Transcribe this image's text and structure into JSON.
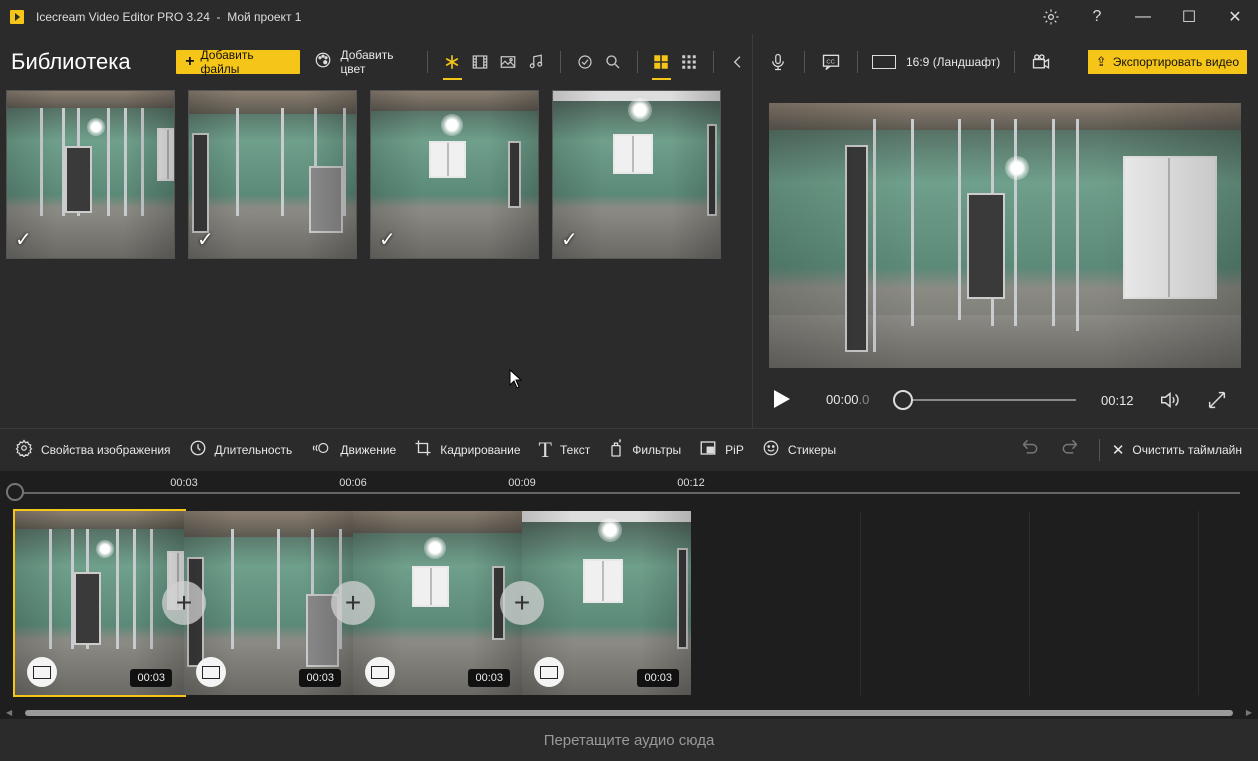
{
  "window": {
    "title": "Icecream Video Editor PRO 3.24  -  Мой проект 1",
    "settings_icon": "gear-icon",
    "help_label": "?",
    "minimize_label": "—",
    "maximize_label": "☐",
    "close_label": "✕"
  },
  "library": {
    "title": "Библиотека",
    "add_files_label": "Добавить файлы",
    "add_color_label": "Добавить цвет",
    "items": [
      {
        "checked": true
      },
      {
        "checked": true
      },
      {
        "checked": true
      },
      {
        "checked": true
      }
    ],
    "check_glyph": "✓"
  },
  "right_toolbar": {
    "aspect_label": "16:9 (Ландшафт)",
    "export_label": "Экспортировать видео"
  },
  "player": {
    "current_time_main": "00:00",
    "current_time_frac": ".0",
    "total_time": "00:12",
    "progress": 0
  },
  "edit_toolbar": {
    "image_props": "Свойства изображения",
    "duration": "Длительность",
    "motion": "Движение",
    "crop": "Кадрирование",
    "text": "Текст",
    "filters": "Фильтры",
    "pip": "PiP",
    "stickers": "Стикеры",
    "clear_timeline": "Очистить таймлайн"
  },
  "timeline": {
    "ticks": [
      "00:03",
      "00:06",
      "00:09",
      "00:12"
    ],
    "clips": [
      {
        "duration": "00:03",
        "selected": true
      },
      {
        "duration": "00:03",
        "selected": false
      },
      {
        "duration": "00:03",
        "selected": false
      },
      {
        "duration": "00:03",
        "selected": false
      }
    ],
    "add_transition_glyph": "+"
  },
  "audio_drop": {
    "label": "Перетащите аудио сюда"
  },
  "colors": {
    "accent": "#f5c518",
    "background": "#2b2b2b",
    "timeline_bg": "#1e1e1e"
  }
}
